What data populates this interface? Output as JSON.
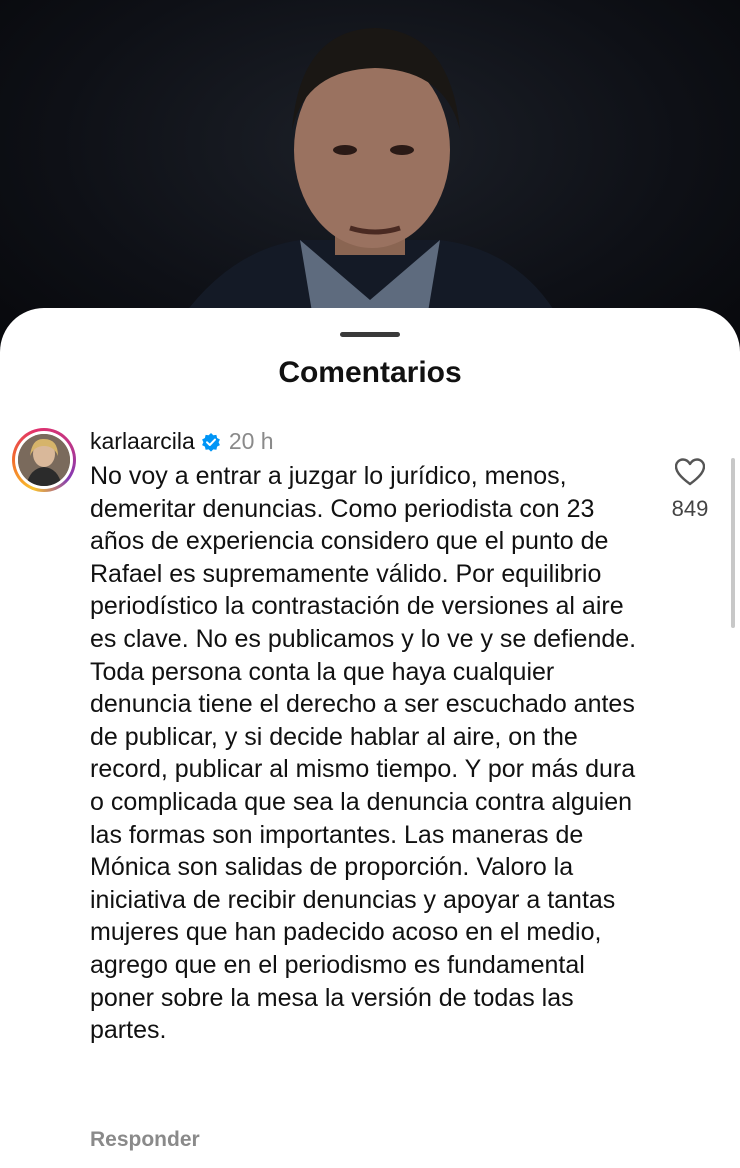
{
  "sheet": {
    "title": "Comentarios"
  },
  "comment": {
    "username": "karlaarcila",
    "verified_icon": "verified-badge-icon",
    "time": "20 h",
    "text": "No voy a entrar a juzgar lo jurídico, menos, demeritar denuncias. Como periodista con 23 años de experiencia considero que el punto de Rafael es supremamente válido. Por equilibrio periodístico la contrastación de versiones al aire es clave. No es publicamos y lo ve y se defiende. Toda persona conta la que haya cualquier denuncia tiene el derecho a ser escuchado antes de publicar, y si decide hablar al aire, on the record, publicar al mismo tiempo. Y por más dura o complicada que sea la denuncia contra alguien las formas son importantes. Las maneras de Mónica son salidas de proporción. Valoro la iniciativa de recibir denuncias y apoyar a tantas mujeres que han padecido acoso en el medio, agrego que en el periodismo es fundamental poner sobre la mesa la versión de todas las partes.",
    "likes": "849",
    "like_icon": "heart-outline-icon",
    "reply_label": "Responder"
  },
  "colors": {
    "verified": "#0095f6",
    "ring": [
      "#f9c22e",
      "#e1306c",
      "#833ab4"
    ]
  }
}
